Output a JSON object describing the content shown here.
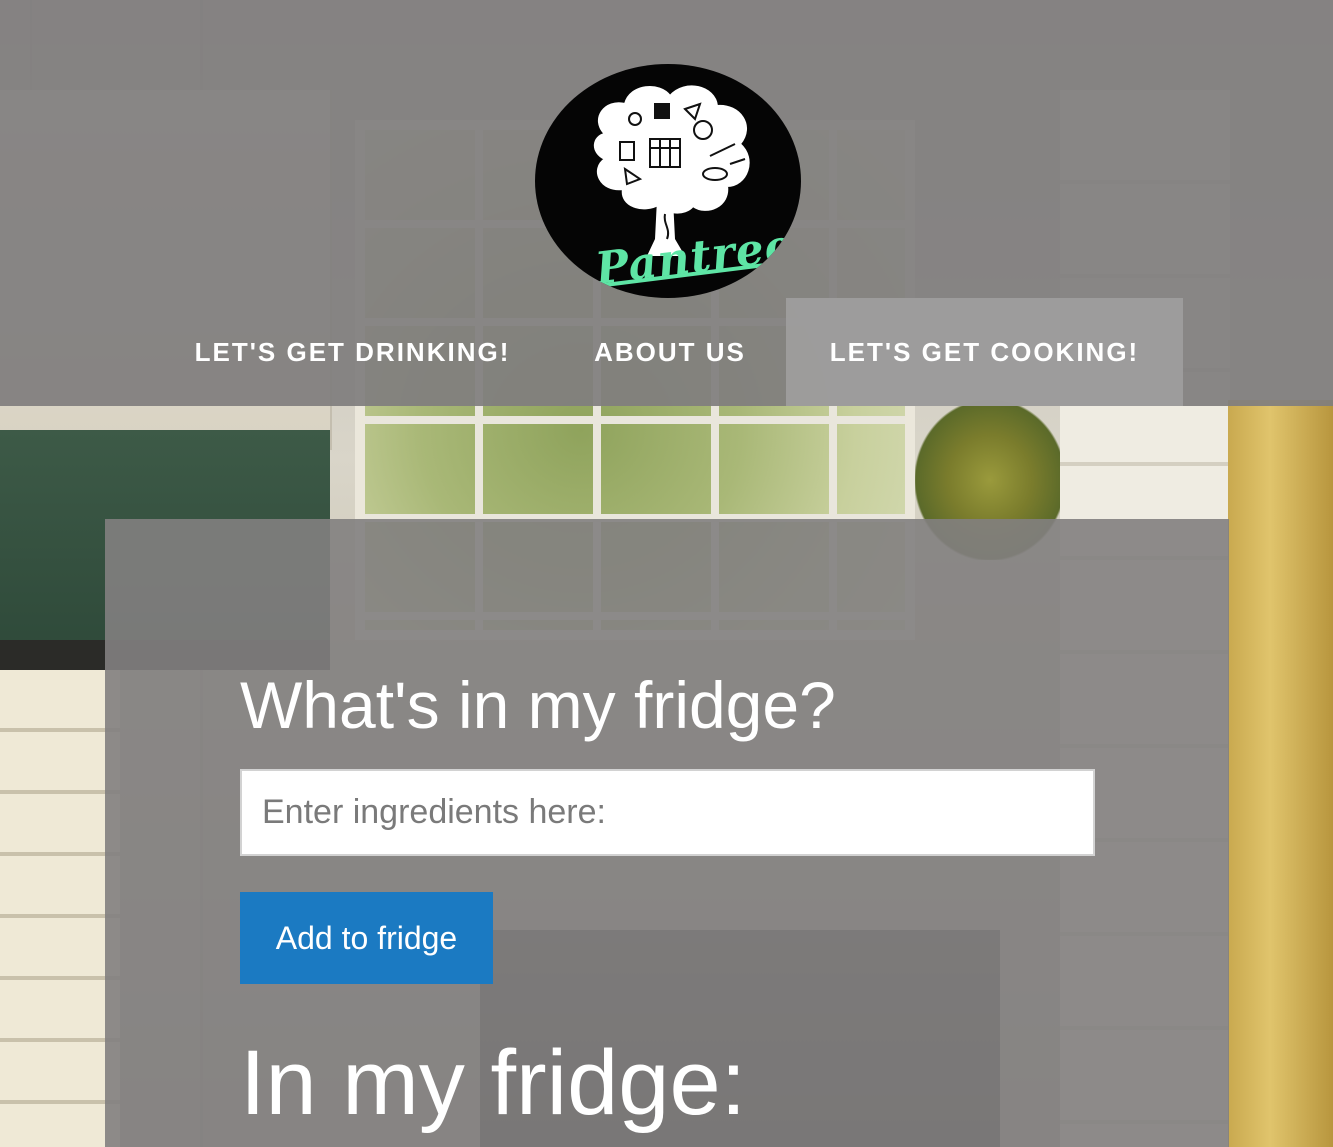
{
  "brand": {
    "logo_text": "Pantree",
    "accent_color": "#5ee5a5"
  },
  "nav": {
    "items": [
      {
        "label": "LET'S GET DRINKING!",
        "active": false
      },
      {
        "label": "ABOUT US",
        "active": false
      },
      {
        "label": "LET'S GET COOKING!",
        "active": true
      }
    ]
  },
  "main": {
    "title": "What's in my fridge?",
    "input_placeholder": "Enter ingredients here:",
    "input_value": "",
    "add_button_label": "Add to fridge",
    "button_color": "#1b7ac2",
    "fridge_heading": "In my fridge:"
  }
}
